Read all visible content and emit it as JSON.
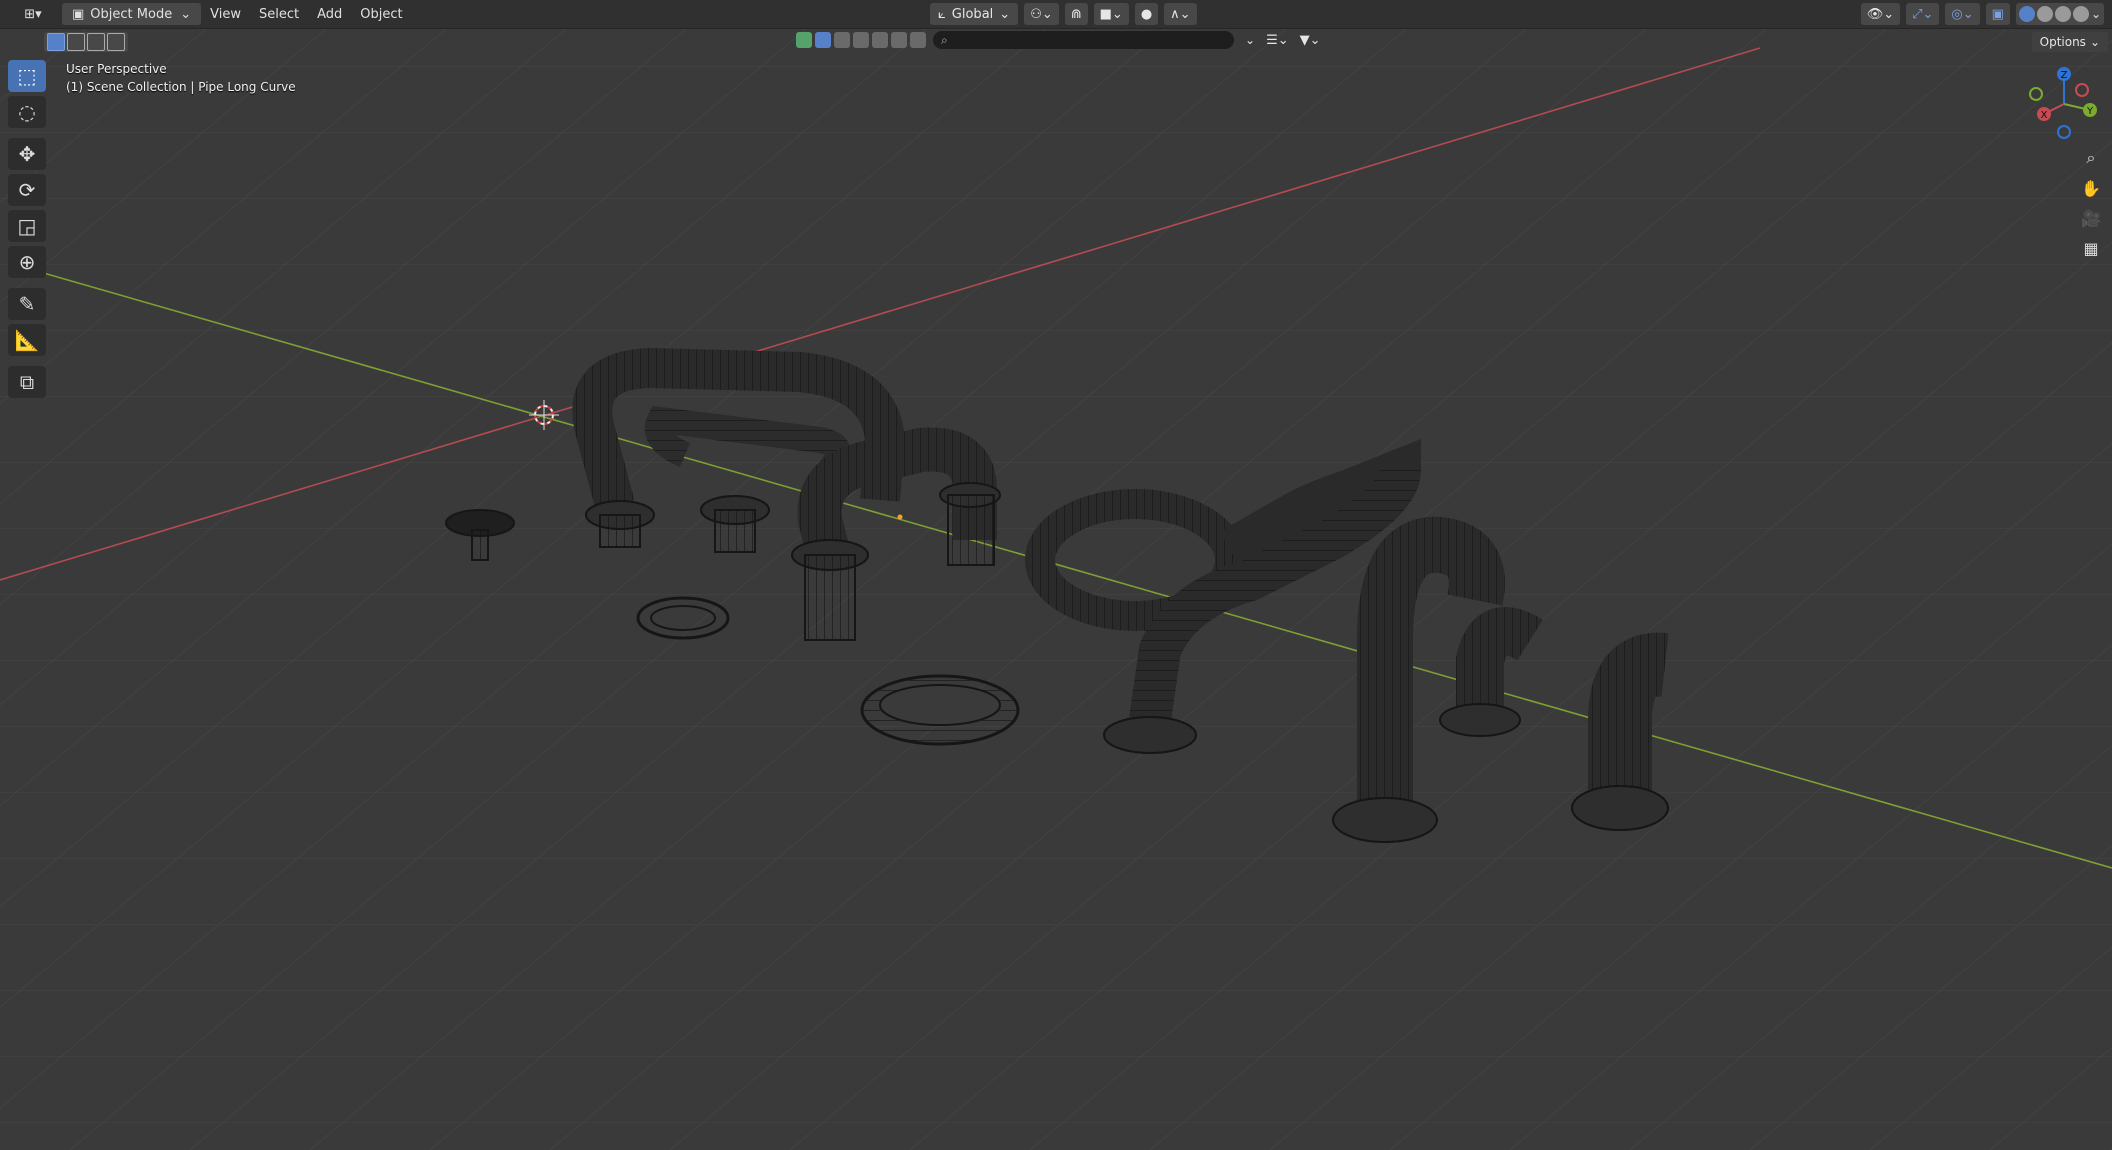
{
  "header": {
    "editor_type_icon": "3d-viewport-icon",
    "mode": "Object Mode",
    "menus": [
      "View",
      "Select",
      "Add",
      "Object"
    ],
    "transform_orientation": "Global",
    "options_label": "Options"
  },
  "search": {
    "placeholder": "",
    "value": ""
  },
  "viewport": {
    "view_name": "User Perspective",
    "collection_info": "(1) Scene Collection | Pipe Long Curve"
  },
  "toolbar": {
    "tools": [
      "select-box-icon",
      "cursor-icon",
      "move-icon",
      "rotate-icon",
      "scale-icon",
      "transform-icon",
      "annotate-icon",
      "measure-icon",
      "add-cube-icon"
    ],
    "active_tool": "select-box-icon"
  },
  "gizmo": {
    "x_label": "X",
    "y_label": "Y",
    "z_label": "Z"
  },
  "colors": {
    "header_bg": "#303030",
    "viewport_bg": "#3a3a3a",
    "accent": "#4772b3",
    "axis_x": "#c74b55",
    "axis_y": "#7bab2f",
    "axis_z": "#2f73d6",
    "wire": "#1a1a1a"
  }
}
